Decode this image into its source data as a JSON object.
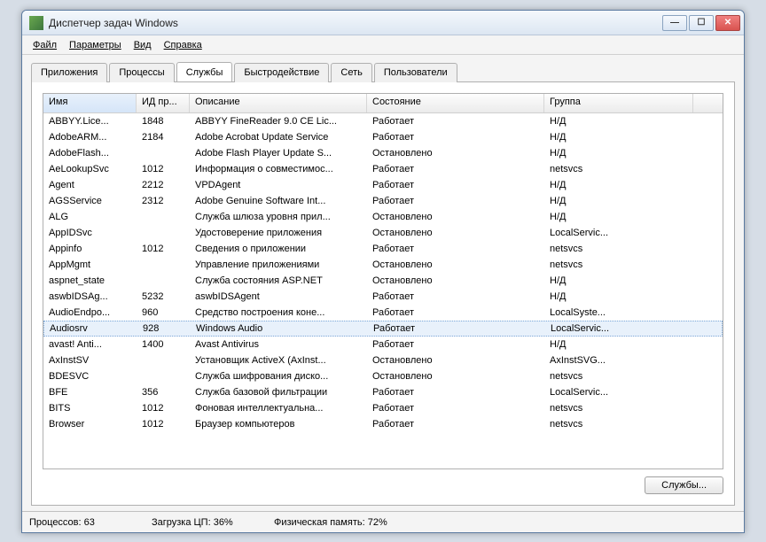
{
  "window": {
    "title": "Диспетчер задач Windows"
  },
  "menu": {
    "file": "Файл",
    "options": "Параметры",
    "view": "Вид",
    "help": "Справка"
  },
  "tabs": {
    "applications": "Приложения",
    "processes": "Процессы",
    "services": "Службы",
    "performance": "Быстродействие",
    "network": "Сеть",
    "users": "Пользователи"
  },
  "columns": {
    "name": "Имя",
    "pid": "ИД пр...",
    "desc": "Описание",
    "status": "Состояние",
    "group": "Группа"
  },
  "rows": [
    {
      "name": "ABBYY.Lice...",
      "pid": "1848",
      "desc": "ABBYY FineReader 9.0 CE Lic...",
      "status": "Работает",
      "group": "Н/Д"
    },
    {
      "name": "AdobeARM...",
      "pid": "2184",
      "desc": "Adobe Acrobat Update Service",
      "status": "Работает",
      "group": "Н/Д"
    },
    {
      "name": "AdobeFlash...",
      "pid": "",
      "desc": "Adobe Flash Player Update S...",
      "status": "Остановлено",
      "group": "Н/Д"
    },
    {
      "name": "AeLookupSvc",
      "pid": "1012",
      "desc": "Информация о совместимос...",
      "status": "Работает",
      "group": "netsvcs"
    },
    {
      "name": "Agent",
      "pid": "2212",
      "desc": "VPDAgent",
      "status": "Работает",
      "group": "Н/Д"
    },
    {
      "name": "AGSService",
      "pid": "2312",
      "desc": "Adobe Genuine Software Int...",
      "status": "Работает",
      "group": "Н/Д"
    },
    {
      "name": "ALG",
      "pid": "",
      "desc": "Служба шлюза уровня прил...",
      "status": "Остановлено",
      "group": "Н/Д"
    },
    {
      "name": "AppIDSvc",
      "pid": "",
      "desc": "Удостоверение приложения",
      "status": "Остановлено",
      "group": "LocalServic..."
    },
    {
      "name": "Appinfo",
      "pid": "1012",
      "desc": "Сведения о приложении",
      "status": "Работает",
      "group": "netsvcs"
    },
    {
      "name": "AppMgmt",
      "pid": "",
      "desc": "Управление приложениями",
      "status": "Остановлено",
      "group": "netsvcs"
    },
    {
      "name": "aspnet_state",
      "pid": "",
      "desc": "Служба состояния ASP.NET",
      "status": "Остановлено",
      "group": "Н/Д"
    },
    {
      "name": "aswbIDSAg...",
      "pid": "5232",
      "desc": "aswbIDSAgent",
      "status": "Работает",
      "group": "Н/Д"
    },
    {
      "name": "AudioEndpo...",
      "pid": "960",
      "desc": "Средство построения коне...",
      "status": "Работает",
      "group": "LocalSyste..."
    },
    {
      "name": "Audiosrv",
      "pid": "928",
      "desc": "Windows Audio",
      "status": "Работает",
      "group": "LocalServic...",
      "selected": true
    },
    {
      "name": "avast! Anti...",
      "pid": "1400",
      "desc": "Avast Antivirus",
      "status": "Работает",
      "group": "Н/Д"
    },
    {
      "name": "AxInstSV",
      "pid": "",
      "desc": "Установщик ActiveX (AxInst...",
      "status": "Остановлено",
      "group": "AxInstSVG..."
    },
    {
      "name": "BDESVC",
      "pid": "",
      "desc": "Служба шифрования диско...",
      "status": "Остановлено",
      "group": "netsvcs"
    },
    {
      "name": "BFE",
      "pid": "356",
      "desc": "Служба базовой фильтрации",
      "status": "Работает",
      "group": "LocalServic..."
    },
    {
      "name": "BITS",
      "pid": "1012",
      "desc": "Фоновая интеллектуальна...",
      "status": "Работает",
      "group": "netsvcs"
    },
    {
      "name": "Browser",
      "pid": "1012",
      "desc": "Браузер компьютеров",
      "status": "Работает",
      "group": "netsvcs"
    }
  ],
  "services_button": "Службы...",
  "status": {
    "processes": "Процессов: 63",
    "cpu": "Загрузка ЦП: 36%",
    "mem": "Физическая память: 72%"
  }
}
